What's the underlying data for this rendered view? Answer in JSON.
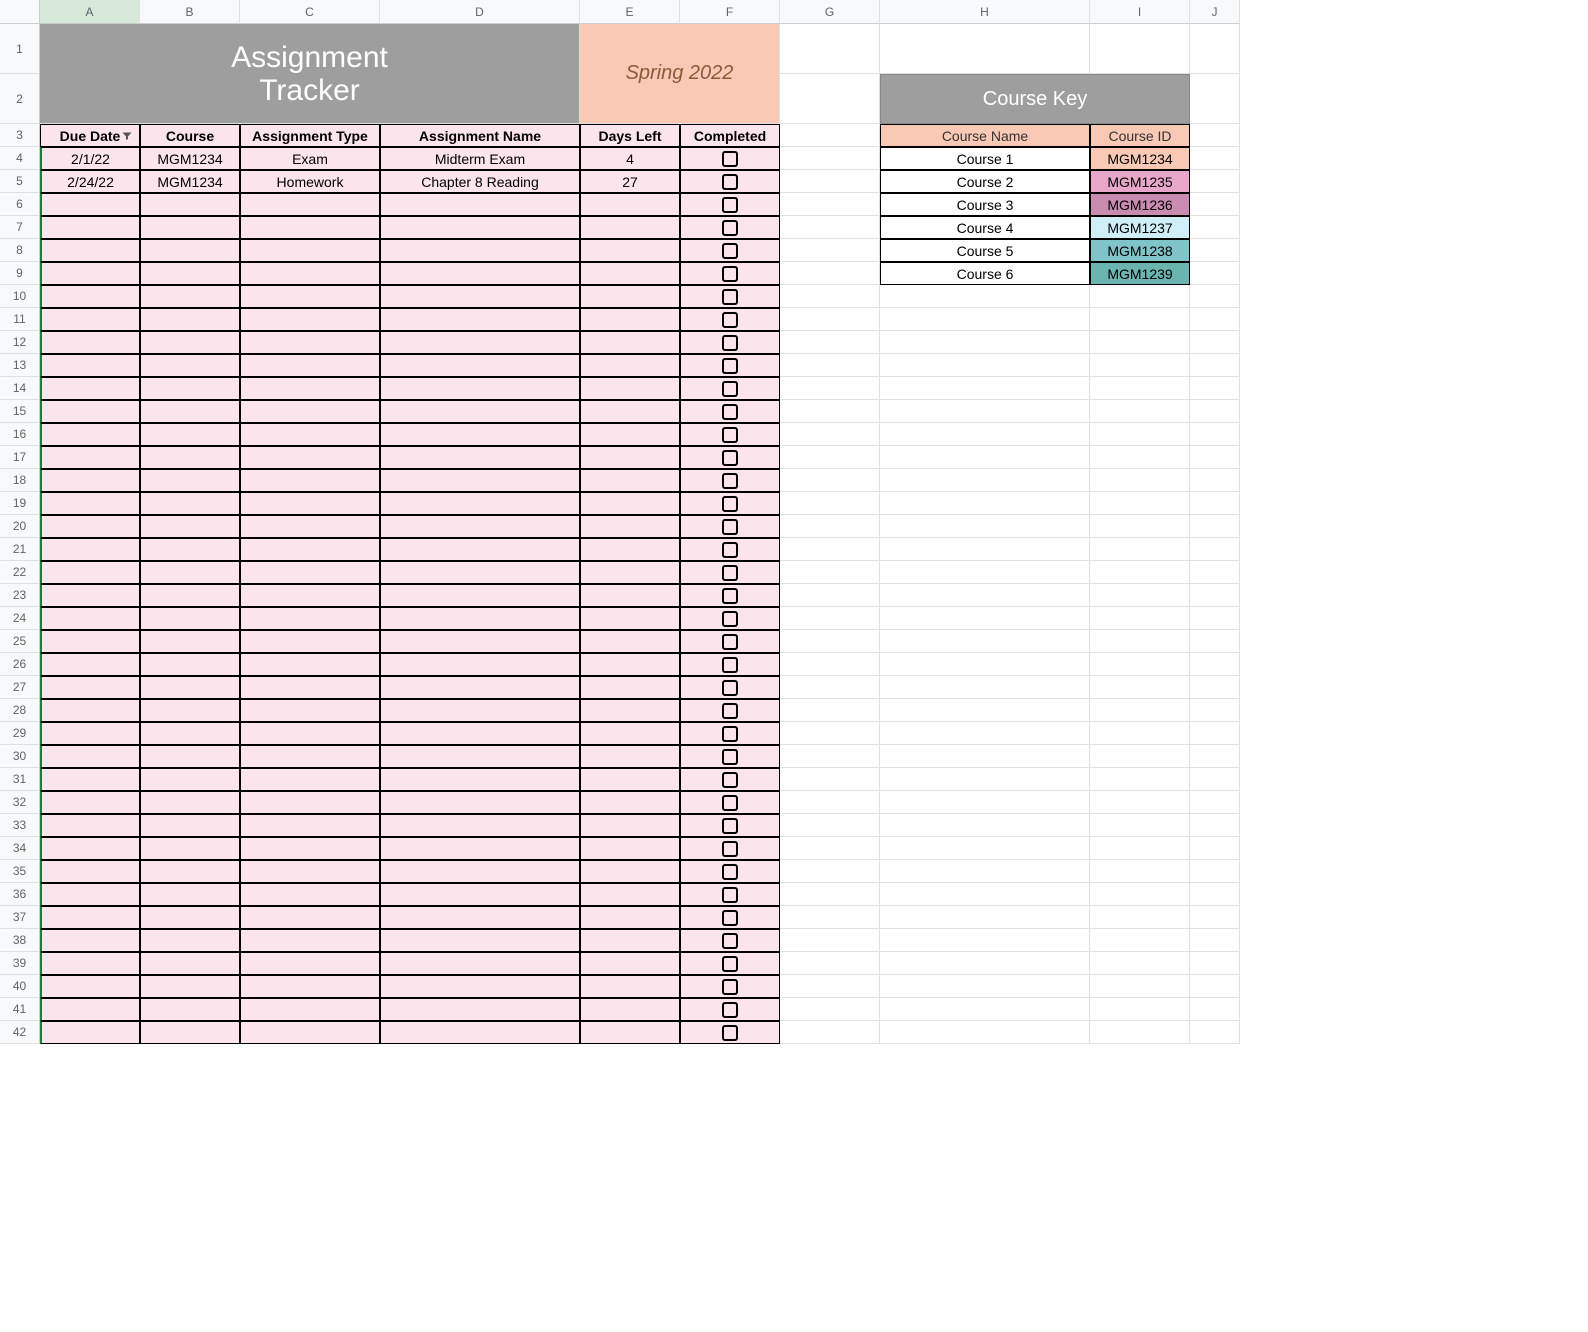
{
  "columns": [
    "",
    "A",
    "B",
    "C",
    "D",
    "E",
    "F",
    "G",
    "H",
    "I",
    "J"
  ],
  "title_line1": "Assignment",
  "title_line2": "Tracker",
  "semester": "Spring 2022",
  "tracker_headers": {
    "due_date": "Due Date",
    "course": "Course",
    "assignment_type": "Assignment Type",
    "assignment_name": "Assignment Name",
    "days_left": "Days Left",
    "completed": "Completed"
  },
  "tracker_rows": [
    {
      "due_date": "2/1/22",
      "course": "MGM1234",
      "assignment_type": "Exam",
      "assignment_name": "Midterm Exam",
      "days_left": "4",
      "completed": false
    },
    {
      "due_date": "2/24/22",
      "course": "MGM1234",
      "assignment_type": "Homework",
      "assignment_name": "Chapter 8 Reading",
      "days_left": "27",
      "completed": false
    }
  ],
  "empty_tracker_rows": 37,
  "course_key": {
    "title": "Course Key",
    "headers": {
      "name": "Course Name",
      "id": "Course ID"
    },
    "rows": [
      {
        "name": "Course 1",
        "id": "MGM1234",
        "color": "#f9c9b6"
      },
      {
        "name": "Course 2",
        "id": "MGM1235",
        "color": "#e8a6c9"
      },
      {
        "name": "Course 3",
        "id": "MGM1236",
        "color": "#c98bb0"
      },
      {
        "name": "Course 4",
        "id": "MGM1237",
        "color": "#cfeef7"
      },
      {
        "name": "Course 5",
        "id": "MGM1238",
        "color": "#7fc4c9"
      },
      {
        "name": "Course 6",
        "id": "MGM1239",
        "color": "#6bb5b0"
      }
    ]
  },
  "row_count": 42
}
